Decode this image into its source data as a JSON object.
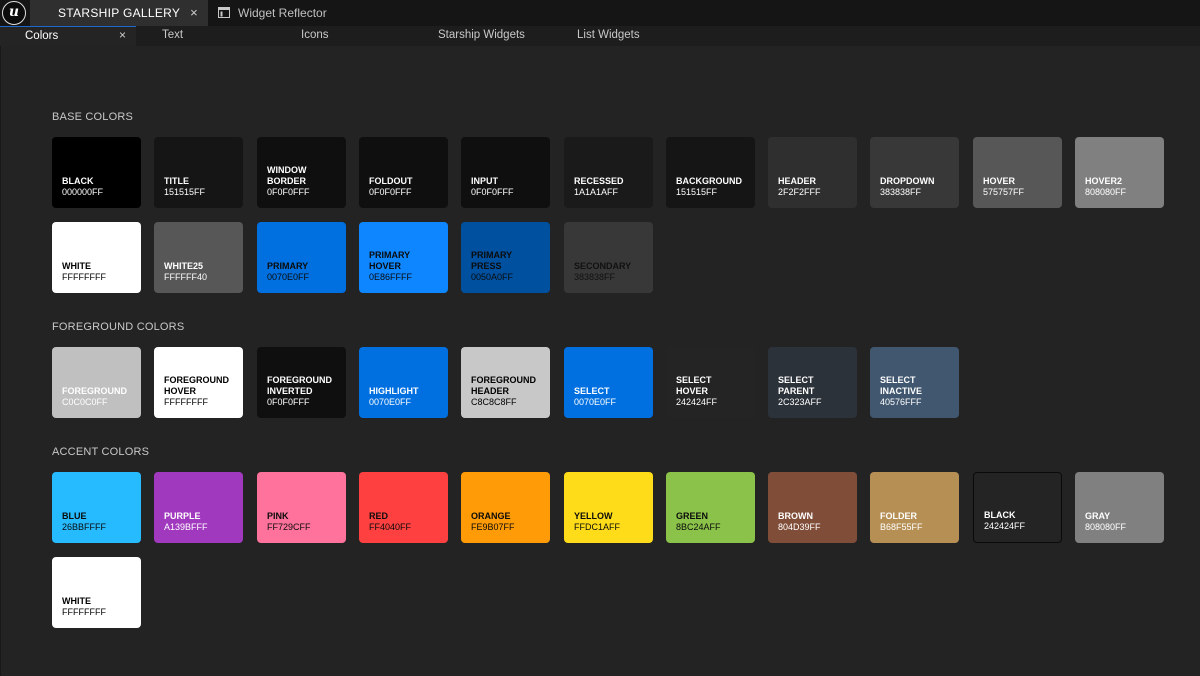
{
  "window": {
    "tabs": [
      {
        "label": "STARSHIP GALLERY",
        "active": true
      },
      {
        "label": "Widget Reflector",
        "active": false
      }
    ],
    "close_glyph": "×"
  },
  "subtabs": [
    "Colors",
    "Text",
    "Icons",
    "Starship Widgets",
    "List Widgets"
  ],
  "sections": [
    {
      "title": "BASE COLORS",
      "swatches": [
        {
          "name": "BLACK",
          "hex": "000000FF",
          "color": "#000000",
          "text": "#ffffff"
        },
        {
          "name": "TITLE",
          "hex": "151515FF",
          "color": "#151515",
          "text": "#ffffff"
        },
        {
          "name": "WINDOW\nBORDER",
          "hex": "0F0F0FFF",
          "color": "#0f0f0f",
          "text": "#ffffff"
        },
        {
          "name": "FOLDOUT",
          "hex": "0F0F0FFF",
          "color": "#0f0f0f",
          "text": "#ffffff"
        },
        {
          "name": "INPUT",
          "hex": "0F0F0FFF",
          "color": "#0f0f0f",
          "text": "#ffffff"
        },
        {
          "name": "RECESSED",
          "hex": "1A1A1AFF",
          "color": "#1a1a1a",
          "text": "#ffffff"
        },
        {
          "name": "BACKGROUND",
          "hex": "151515FF",
          "color": "#151515",
          "text": "#ffffff"
        },
        {
          "name": "HEADER",
          "hex": "2F2F2FFF",
          "color": "#2f2f2f",
          "text": "#ffffff"
        },
        {
          "name": "DROPDOWN",
          "hex": "383838FF",
          "color": "#383838",
          "text": "#ffffff"
        },
        {
          "name": "HOVER",
          "hex": "575757FF",
          "color": "#575757",
          "text": "#ffffff"
        },
        {
          "name": "HOVER2",
          "hex": "808080FF",
          "color": "#808080",
          "text": "#ffffff"
        },
        {
          "name": "WHITE",
          "hex": "FFFFFFFF",
          "color": "#ffffff",
          "text": "#000000"
        },
        {
          "name": "WHITE25",
          "hex": "FFFFFF40",
          "color": "#575757",
          "text": "#ffffff"
        },
        {
          "name": "PRIMARY",
          "hex": "0070E0FF",
          "color": "#0070e0",
          "text": "#0b0b0b"
        },
        {
          "name": "PRIMARY\nHOVER",
          "hex": "0E86FFFF",
          "color": "#0e86ff",
          "text": "#0b0b0b"
        },
        {
          "name": "PRIMARY\nPRESS",
          "hex": "0050A0FF",
          "color": "#0050a0",
          "text": "#0b0b0b"
        },
        {
          "name": "SECONDARY",
          "hex": "383838FF",
          "color": "#383838",
          "text": "#111111"
        }
      ]
    },
    {
      "title": "FOREGROUND COLORS",
      "swatches": [
        {
          "name": "FOREGROUND",
          "hex": "C0C0C0FF",
          "color": "#c0c0c0",
          "text": "#ffffff"
        },
        {
          "name": "FOREGROUND\nHOVER",
          "hex": "FFFFFFFF",
          "color": "#ffffff",
          "text": "#000000"
        },
        {
          "name": "FOREGROUND\nINVERTED",
          "hex": "0F0F0FFF",
          "color": "#0f0f0f",
          "text": "#ffffff"
        },
        {
          "name": "HIGHLIGHT",
          "hex": "0070E0FF",
          "color": "#0070e0",
          "text": "#ffffff"
        },
        {
          "name": "FOREGROUND\nHEADER",
          "hex": "C8C8C8FF",
          "color": "#c8c8c8",
          "text": "#000000"
        },
        {
          "name": "SELECT",
          "hex": "0070E0FF",
          "color": "#0070e0",
          "text": "#ffffff"
        },
        {
          "name": "SELECT\nHOVER",
          "hex": "242424FF",
          "color": "#242424",
          "text": "#ffffff"
        },
        {
          "name": "SELECT\nPARENT",
          "hex": "2C323AFF",
          "color": "#2c323a",
          "text": "#ffffff"
        },
        {
          "name": "SELECT\nINACTIVE",
          "hex": "40576FFF",
          "color": "#40576f",
          "text": "#ffffff"
        }
      ]
    },
    {
      "title": "ACCENT COLORS",
      "swatches": [
        {
          "name": "BLUE",
          "hex": "26BBFFFF",
          "color": "#26bbff",
          "text": "#0b0b0b"
        },
        {
          "name": "PURPLE",
          "hex": "A139BFFF",
          "color": "#a139bf",
          "text": "#ffffff"
        },
        {
          "name": "PINK",
          "hex": "FF729CFF",
          "color": "#ff729c",
          "text": "#0b0b0b"
        },
        {
          "name": "RED",
          "hex": "FF4040FF",
          "color": "#ff4040",
          "text": "#0b0b0b"
        },
        {
          "name": "ORANGE",
          "hex": "FE9B07FF",
          "color": "#fe9b07",
          "text": "#0b0b0b"
        },
        {
          "name": "YELLOW",
          "hex": "FFDC1AFF",
          "color": "#ffdc1a",
          "text": "#0b0b0b"
        },
        {
          "name": "GREEN",
          "hex": "8BC24AFF",
          "color": "#8bc24a",
          "text": "#0b0b0b"
        },
        {
          "name": "BROWN",
          "hex": "804D39FF",
          "color": "#804d39",
          "text": "#ffffff"
        },
        {
          "name": "FOLDER",
          "hex": "B68F55FF",
          "color": "#b68f55",
          "text": "#ffffff"
        },
        {
          "name": "BLACK",
          "hex": "242424FF",
          "color": "#242424",
          "text": "#ffffff",
          "border": "#0a0a0a"
        },
        {
          "name": "GRAY",
          "hex": "808080FF",
          "color": "#808080",
          "text": "#ffffff"
        },
        {
          "name": "WHITE",
          "hex": "FFFFFFFF",
          "color": "#ffffff",
          "text": "#000000"
        }
      ]
    }
  ]
}
